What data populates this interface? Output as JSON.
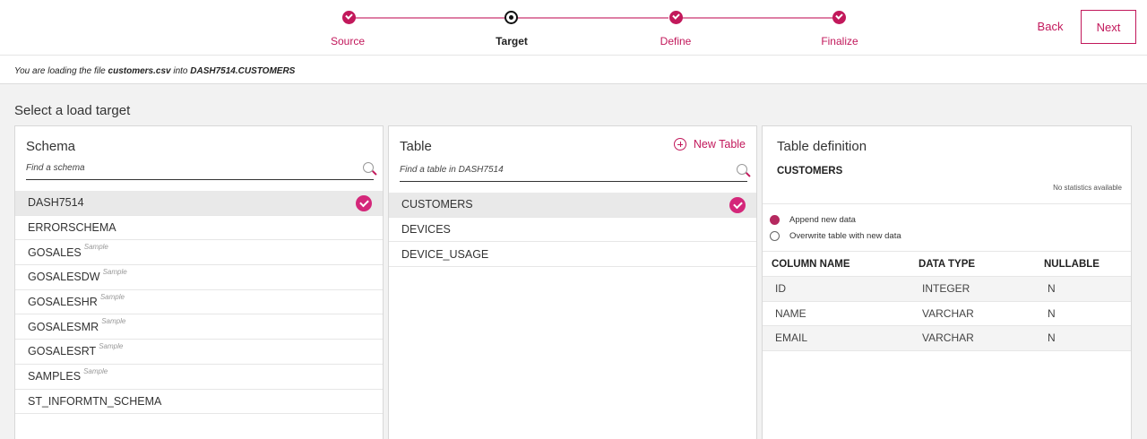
{
  "wizard": {
    "steps": [
      {
        "label": "Source",
        "state": "done"
      },
      {
        "label": "Target",
        "state": "current"
      },
      {
        "label": "Define",
        "state": "done"
      },
      {
        "label": "Finalize",
        "state": "done"
      }
    ],
    "back_label": "Back",
    "next_label": "Next",
    "accent_color": "#c2185b"
  },
  "load_info": {
    "prefix": "You are loading the file ",
    "file": "customers.csv",
    "middle": " into ",
    "target": "DASH7514.CUSTOMERS"
  },
  "section_title": "Select a load target",
  "schema_panel": {
    "title": "Schema",
    "search_placeholder": "Find a schema",
    "items": [
      {
        "name": "DASH7514",
        "sample": "",
        "selected": true
      },
      {
        "name": "ERRORSCHEMA",
        "sample": "",
        "selected": false
      },
      {
        "name": "GOSALES",
        "sample": "Sample",
        "selected": false
      },
      {
        "name": "GOSALESDW",
        "sample": "Sample",
        "selected": false
      },
      {
        "name": "GOSALESHR",
        "sample": "Sample",
        "selected": false
      },
      {
        "name": "GOSALESMR",
        "sample": "Sample",
        "selected": false
      },
      {
        "name": "GOSALESRT",
        "sample": "Sample",
        "selected": false
      },
      {
        "name": "SAMPLES",
        "sample": "Sample",
        "selected": false
      },
      {
        "name": "ST_INFORMTN_SCHEMA",
        "sample": "",
        "selected": false
      }
    ]
  },
  "table_panel": {
    "title": "Table",
    "new_table_label": "New Table",
    "search_placeholder": "Find a table in DASH7514",
    "items": [
      {
        "name": "CUSTOMERS",
        "selected": true
      },
      {
        "name": "DEVICES",
        "selected": false
      },
      {
        "name": "DEVICE_USAGE",
        "selected": false
      }
    ]
  },
  "definition_panel": {
    "title": "Table definition",
    "table_name": "CUSTOMERS",
    "stats_text": "No statistics available",
    "options": [
      {
        "label": "Append new data",
        "checked": true
      },
      {
        "label": "Overwrite table with new data",
        "checked": false
      }
    ],
    "columns_header": {
      "name": "COLUMN NAME",
      "type": "DATA TYPE",
      "nullable": "NULLABLE"
    },
    "columns": [
      {
        "name": "ID",
        "type": "INTEGER",
        "nullable": "N"
      },
      {
        "name": "NAME",
        "type": "VARCHAR",
        "nullable": "N"
      },
      {
        "name": "EMAIL",
        "type": "VARCHAR",
        "nullable": "N"
      }
    ]
  }
}
